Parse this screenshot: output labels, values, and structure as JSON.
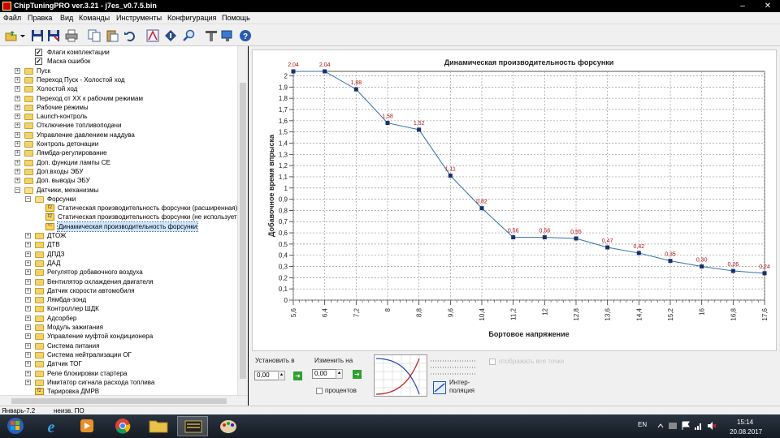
{
  "window": {
    "title": "ChipTuningPRO ver.3.21 - j7es_v0.7.5.bin",
    "controls": {
      "minimize": "–",
      "close": "✕"
    }
  },
  "menu": [
    "Файл",
    "Правка",
    "Вид",
    "Команды",
    "Инструменты",
    "Конфигурация",
    "Помощь"
  ],
  "toolbar_icons": [
    "open-icon",
    "dropdown-arrow-icon",
    "save-icon",
    "save-as-icon",
    "print-icon",
    "copy-icon",
    "paste-icon",
    "undo-icon",
    "calibrate-icon",
    "info-icon",
    "search-icon",
    "tools-icon",
    "connect-icon",
    "help-icon"
  ],
  "tree": [
    {
      "level": 1,
      "icon": "checkbox",
      "checked": true,
      "label": "Флаги комплектации"
    },
    {
      "level": 1,
      "icon": "checkbox",
      "checked": true,
      "label": "Маска ошибок"
    },
    {
      "level": 0,
      "icon": "folder",
      "expander": "+",
      "label": "Пуск"
    },
    {
      "level": 0,
      "icon": "folder",
      "expander": "+",
      "label": "Переход Пуск - Холостой ход"
    },
    {
      "level": 0,
      "icon": "folder",
      "expander": "+",
      "label": "Холостой ход"
    },
    {
      "level": 0,
      "icon": "folder",
      "expander": "+",
      "label": "Переход от ХХ к рабочим режимам"
    },
    {
      "level": 0,
      "icon": "folder",
      "expander": "+",
      "label": "Рабочие режимы"
    },
    {
      "level": 0,
      "icon": "folder",
      "expander": "+",
      "label": "Launch-контроль"
    },
    {
      "level": 0,
      "icon": "folder",
      "expander": "+",
      "label": "Отключение топливоподачи"
    },
    {
      "level": 0,
      "icon": "folder",
      "expander": "+",
      "label": "Управление давлением наддува"
    },
    {
      "level": 0,
      "icon": "folder",
      "expander": "+",
      "label": "Контроль детонации"
    },
    {
      "level": 0,
      "icon": "folder",
      "expander": "+",
      "label": "Лямбда-регулирование"
    },
    {
      "level": 0,
      "icon": "folder",
      "expander": "+",
      "label": "Доп. функции лампы CE"
    },
    {
      "level": 0,
      "icon": "folder",
      "expander": "+",
      "label": "Доп.входы ЭБУ"
    },
    {
      "level": 0,
      "icon": "folder",
      "expander": "+",
      "label": "Доп. выводы ЭБУ"
    },
    {
      "level": 0,
      "icon": "folder-open",
      "expander": "−",
      "label": "Датчики, механизмы"
    },
    {
      "level": 1,
      "icon": "folder-open",
      "expander": "−",
      "label": "Форсунки"
    },
    {
      "level": 2,
      "icon": "table",
      "label": "Статическая производительность форсунки (расширенная)"
    },
    {
      "level": 2,
      "icon": "table",
      "label": "Статическая производительность форсунки (не используется"
    },
    {
      "level": 2,
      "icon": "table",
      "label": "Динамическая производительность форсунки",
      "selected": true
    },
    {
      "level": 1,
      "icon": "folder",
      "expander": "+",
      "label": "ДТОЖ"
    },
    {
      "level": 1,
      "icon": "folder",
      "expander": "+",
      "label": "ДТВ"
    },
    {
      "level": 1,
      "icon": "folder",
      "expander": "+",
      "label": "ДПДЗ"
    },
    {
      "level": 1,
      "icon": "folder",
      "expander": "+",
      "label": "ДАД"
    },
    {
      "level": 1,
      "icon": "folder",
      "expander": "+",
      "label": "Регулятор добавочного воздуха"
    },
    {
      "level": 1,
      "icon": "folder",
      "expander": "+",
      "label": "Вентилятор охлаждения двигателя"
    },
    {
      "level": 1,
      "icon": "folder",
      "expander": "+",
      "label": "Датчик скорости автомобиля"
    },
    {
      "level": 1,
      "icon": "folder",
      "expander": "+",
      "label": "Лямбда-зонд"
    },
    {
      "level": 1,
      "icon": "folder",
      "expander": "+",
      "label": "Контроллер ШДК"
    },
    {
      "level": 1,
      "icon": "folder",
      "expander": "+",
      "label": "Адсорбер"
    },
    {
      "level": 1,
      "icon": "folder",
      "expander": "+",
      "label": "Модуль зажигания"
    },
    {
      "level": 1,
      "icon": "folder",
      "expander": "+",
      "label": "Управление муфтой кондиционера"
    },
    {
      "level": 1,
      "icon": "folder",
      "expander": "+",
      "label": "Система питания"
    },
    {
      "level": 1,
      "icon": "folder",
      "expander": "+",
      "label": "Система нейтрализации ОГ"
    },
    {
      "level": 1,
      "icon": "folder",
      "expander": "+",
      "label": "Датчик ТОГ"
    },
    {
      "level": 1,
      "icon": "folder",
      "expander": "+",
      "label": "Реле блокировки стартера"
    },
    {
      "level": 1,
      "icon": "folder",
      "expander": "+",
      "label": "Имитатор сигнала расхода топлива"
    },
    {
      "level": 1,
      "icon": "table",
      "label": "Тарировка ДМРВ"
    }
  ],
  "chart_data": {
    "type": "line",
    "title": "Динамическая производительность форсунки",
    "xlabel": "Бортовое напряжение",
    "ylabel": "Добавочное время впрыска",
    "x": [
      5.6,
      6.4,
      7.2,
      8.0,
      8.8,
      9.6,
      10.4,
      11.2,
      12.0,
      12.8,
      13.6,
      14.4,
      15.2,
      16.0,
      16.8,
      17.6
    ],
    "x_tick_labels": [
      "5,6",
      "6,4",
      "7,2",
      "8",
      "8,8",
      "9,6",
      "10,4",
      "11,2",
      "12",
      "12,8",
      "13,6",
      "14,4",
      "15,2",
      "16",
      "16,8",
      "17,6"
    ],
    "values": [
      2.04,
      2.04,
      1.88,
      1.58,
      1.52,
      1.11,
      0.82,
      0.56,
      0.56,
      0.55,
      0.47,
      0.42,
      0.35,
      0.3,
      0.26,
      0.24
    ],
    "data_labels": [
      "2,04",
      "2,04",
      "1,88",
      "1,58",
      "1,52",
      "1,11",
      "0,82",
      "0,56",
      "0,56",
      "0,55",
      "0,47",
      "0,42",
      "0,35",
      "0,30",
      "0,26",
      "0,24"
    ],
    "y_tick_labels": [
      "0",
      "0,1",
      "0,2",
      "0,3",
      "0,4",
      "0,5",
      "0,6",
      "0,7",
      "0,8",
      "0,9",
      "1",
      "1,1",
      "1,2",
      "1,3",
      "1,4",
      "1,5",
      "1,6",
      "1,7",
      "1,8",
      "1,9",
      "2"
    ],
    "ylim": [
      0,
      2.04
    ],
    "xlim": [
      5.6,
      17.6
    ],
    "grid": true,
    "colors": {
      "line": "#2f6fa8",
      "marker": "#1a2f6e",
      "label": "#b01010"
    }
  },
  "controls": {
    "set_to_label": "Установить в",
    "set_to_value": "0,00",
    "change_by_label": "Изменить на",
    "change_by_value": "0,00",
    "percent_label": "процентов",
    "interpolation_label_1": "Интер-",
    "interpolation_label_2": "поляция",
    "show_all_label": "отображать все точки",
    "go_symbol": "➔"
  },
  "status": {
    "firmware": "Январь-7.2",
    "version": "неизв. ПО"
  },
  "taskbar": {
    "apps": [
      "windows-start-icon",
      "internet-explorer-icon",
      "media-player-icon",
      "chrome-icon",
      "file-explorer-icon",
      "chiptuningpro-icon",
      "paint-icon"
    ],
    "lang": "EN",
    "time": "15:14",
    "date": "20.08.2017"
  }
}
